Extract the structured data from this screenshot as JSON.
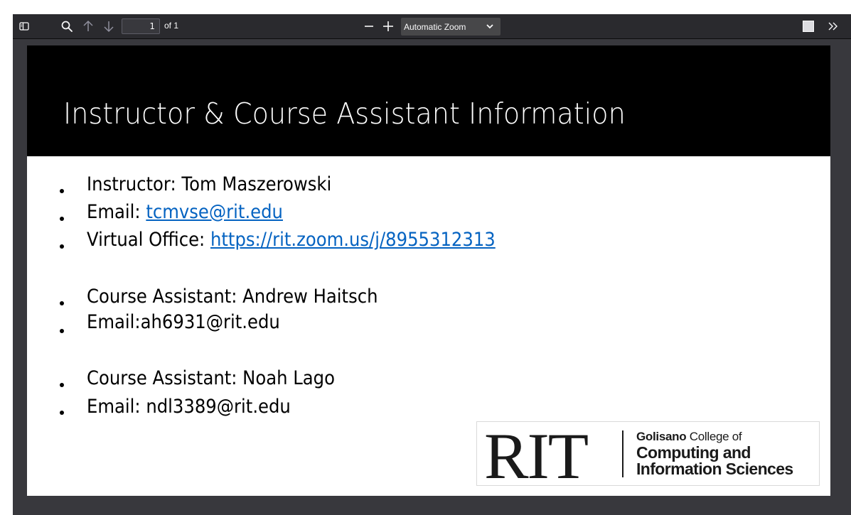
{
  "toolbar": {
    "page_number": "1",
    "page_count_label": "of 1",
    "zoom_value": "Automatic Zoom"
  },
  "slide": {
    "title": "Instructor & Course Assistant Information",
    "items": [
      {
        "text": "Instructor: Tom Maszerowski",
        "link": ""
      },
      {
        "text": "Email: ",
        "link": "tcmvse@rit.edu"
      },
      {
        "text": "Virtual Office: ",
        "link": "https://rit.zoom.us/j/8955312313"
      },
      {
        "text": "Course Assistant: Andrew Haitsch",
        "link": ""
      },
      {
        "text": "Email:ah6931@rit.edu",
        "link": ""
      },
      {
        "text": "Course Assistant: Noah Lago",
        "link": ""
      },
      {
        "text": "Email: ndl3389@rit.edu",
        "link": ""
      }
    ],
    "logo": {
      "wordmark": "RIT",
      "line1_bold": "Golisano",
      "line1_rest": " College of",
      "line2": "Computing and",
      "line3": "Information Sciences"
    }
  },
  "colors": {
    "link": "#0563c1",
    "toolbar": "#2a2a2e",
    "viewer_bg": "#38383d",
    "slide_header": "#000000"
  },
  "icons": [
    "sidebar-toggle-icon",
    "search-icon",
    "arrow-up-icon",
    "arrow-down-icon",
    "minus-icon",
    "plus-icon",
    "chevron-down-icon",
    "presentation-mode-icon",
    "double-chevron-right-icon"
  ]
}
